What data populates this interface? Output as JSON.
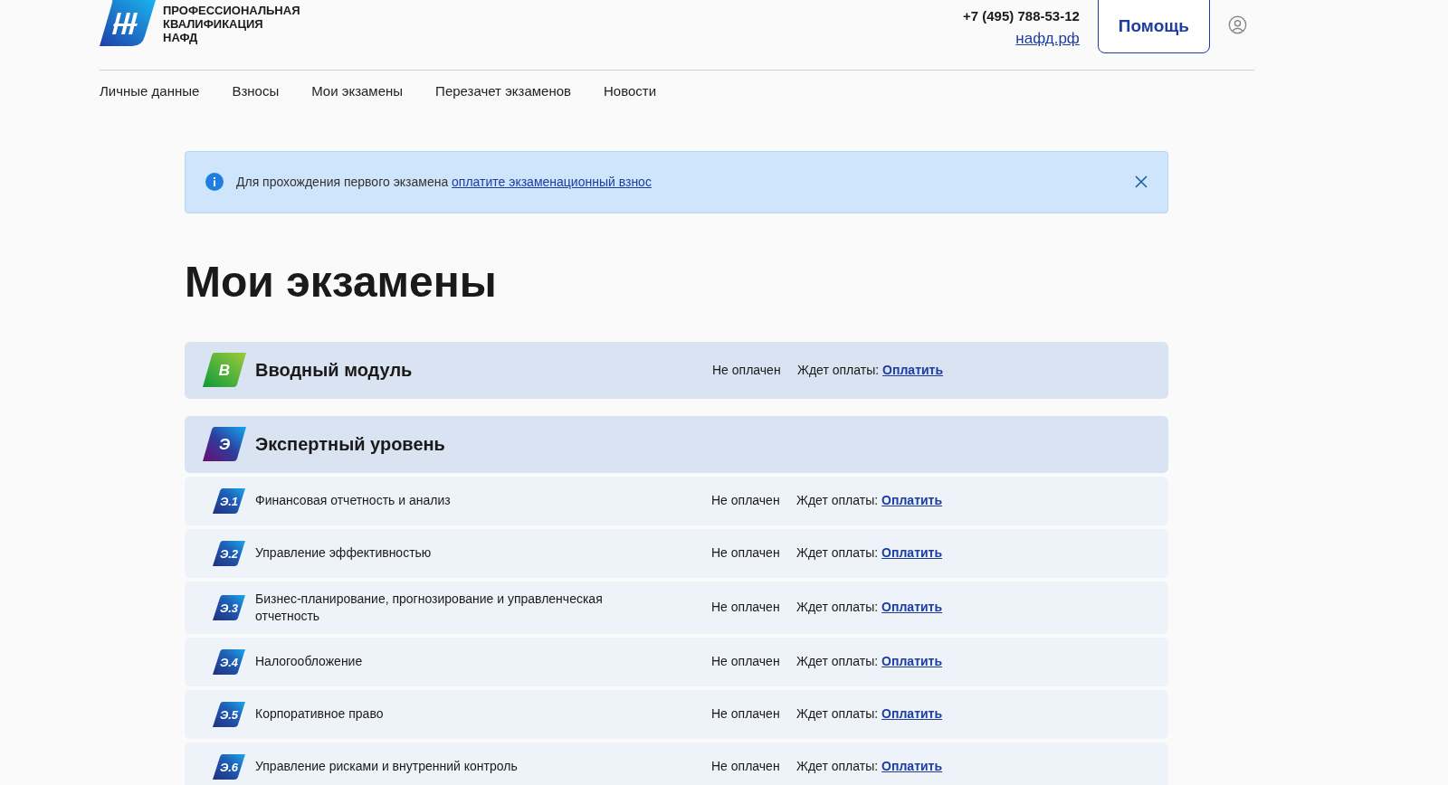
{
  "header": {
    "logo_text": [
      "ПРОФЕССИОНАЛЬНАЯ",
      "КВАЛИФИКАЦИЯ",
      "НАФД"
    ],
    "phone": "+7 (495) 788-53-12",
    "site_link": "нафд.рф",
    "help_button": "Помощь"
  },
  "nav": [
    {
      "label": "Личные данные",
      "selected": false
    },
    {
      "label": "Взносы",
      "selected": false
    },
    {
      "label": "Мои экзамены",
      "selected": false
    },
    {
      "label": "Перезачет экзаменов",
      "selected": false
    },
    {
      "label": "Новости",
      "selected": false
    }
  ],
  "alert": {
    "text": "Для прохождения первого экзамена ",
    "link": "оплатите экзаменационный взнос"
  },
  "title": "Мои экзамены",
  "sections": [
    {
      "kind": "intro",
      "badge": "В",
      "title": "Вводный модуль",
      "status": "Не оплачен",
      "await_label": "Ждет оплаты:",
      "pay_link": "Оплатить"
    },
    {
      "kind": "expert",
      "badge": "Э",
      "title": "Экспертный уровень",
      "items": [
        {
          "badge": "Э.1",
          "title": "Финансовая отчетность и анализ",
          "status": "Не оплачен",
          "await_label": "Ждет оплаты:",
          "pay_link": "Оплатить"
        },
        {
          "badge": "Э.2",
          "title": "Управление эффективностью",
          "status": "Не оплачен",
          "await_label": "Ждет оплаты:",
          "pay_link": "Оплатить"
        },
        {
          "badge": "Э.3",
          "title": "Бизнес-планирование, прогнозирование и управленческая отчетность",
          "status": "Не оплачен",
          "await_label": "Ждет оплаты:",
          "pay_link": "Оплатить"
        },
        {
          "badge": "Э.4",
          "title": "Налогообложение",
          "status": "Не оплачен",
          "await_label": "Ждет оплаты:",
          "pay_link": "Оплатить"
        },
        {
          "badge": "Э.5",
          "title": "Корпоративное право",
          "status": "Не оплачен",
          "await_label": "Ждет оплаты:",
          "pay_link": "Оплатить"
        },
        {
          "badge": "Э.6",
          "title": "Управление рисками и внутренний контроль",
          "status": "Не оплачен",
          "await_label": "Ждет оплаты:",
          "pay_link": "Оплатить"
        }
      ]
    }
  ]
}
